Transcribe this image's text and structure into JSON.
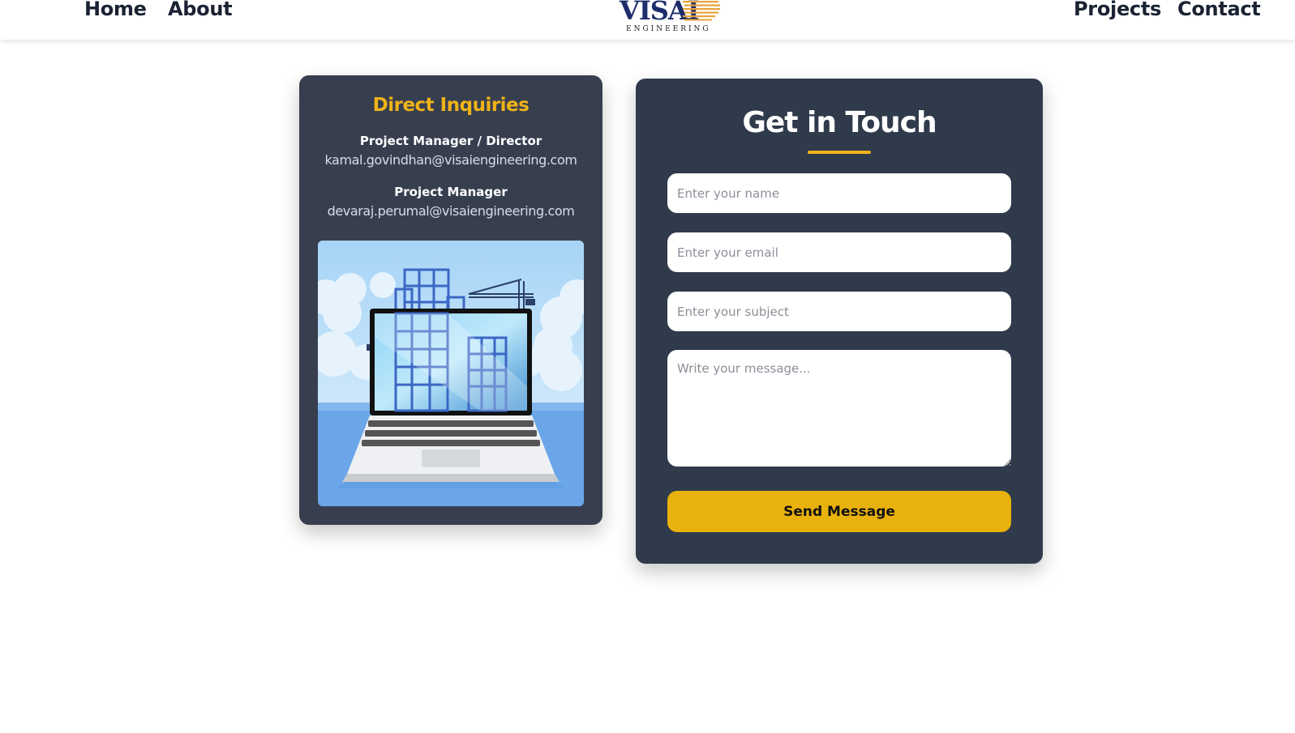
{
  "nav": {
    "home": "Home",
    "about": "About",
    "projects": "Projects",
    "contact": "Contact"
  },
  "logo": {
    "word": "VISAI",
    "sub": "ENGINEERING",
    "colors": {
      "primary": "#1c2d6b",
      "stripes": "#e8a33a"
    }
  },
  "inquiries": {
    "title": "Direct Inquiries",
    "contacts": [
      {
        "role": "Project Manager / Director",
        "email": "kamal.govindhan@visaiengineering.com"
      },
      {
        "role": "Project Manager",
        "email": "devaraj.perumal@visaiengineering.com"
      }
    ],
    "illustration_icon": "laptop-construction-illustration"
  },
  "form": {
    "title": "Get in Touch",
    "name_placeholder": "Enter your name",
    "email_placeholder": "Enter your email",
    "subject_placeholder": "Enter your subject",
    "message_placeholder": "Write your message...",
    "submit_label": "Send Message"
  },
  "colors": {
    "accent": "#f0b318",
    "button": "#e9b10b",
    "card_left": "#373f4f",
    "card_right": "#2f3a4b"
  }
}
